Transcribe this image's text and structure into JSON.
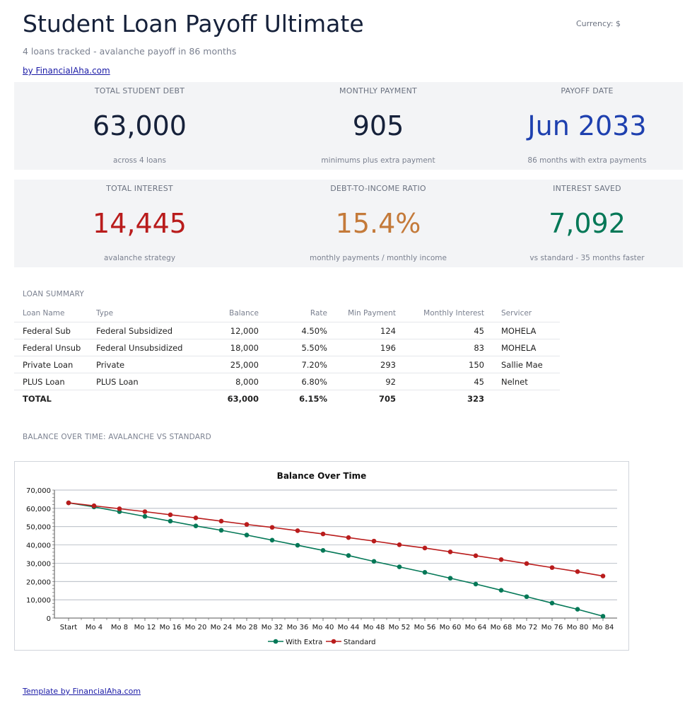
{
  "header": {
    "title": "Student Loan Payoff Ultimate",
    "subtitle": "4 loans tracked - avalanche payoff in 86 months",
    "byline": "by FinancialAha.com",
    "currency": "Currency: $"
  },
  "kpis_row1": [
    {
      "label": "TOTAL STUDENT DEBT",
      "value": "63,000",
      "note": "across 4 loans",
      "color": "#16213a"
    },
    {
      "label": "MONTHLY PAYMENT",
      "value": "905",
      "note": "minimums plus extra payment",
      "color": "#16213a"
    },
    {
      "label": "PAYOFF DATE",
      "value": "Jun 2033",
      "note": "86 months with extra payments",
      "color": "#1e40af"
    }
  ],
  "kpis_row2": [
    {
      "label": "TOTAL INTEREST",
      "value": "14,445",
      "note": "avalanche strategy",
      "color": "#b91c1c"
    },
    {
      "label": "DEBT-TO-INCOME RATIO",
      "value": "15.4%",
      "note": "monthly payments / monthly income",
      "color": "#c47a3a"
    },
    {
      "label": "INTEREST SAVED",
      "value": "7,092",
      "note": "vs standard - 35 months faster",
      "color": "#047857"
    }
  ],
  "loan_summary": {
    "section_label": "LOAN SUMMARY",
    "columns": [
      "Loan Name",
      "Type",
      "Balance",
      "Rate",
      "Min Payment",
      "Monthly Interest",
      "Servicer"
    ],
    "rows": [
      [
        "Federal Sub",
        "Federal Subsidized",
        "12,000",
        "4.50%",
        "124",
        "45",
        "MOHELA"
      ],
      [
        "Federal Unsub",
        "Federal Unsubsidized",
        "18,000",
        "5.50%",
        "196",
        "83",
        "MOHELA"
      ],
      [
        "Private Loan",
        "Private",
        "25,000",
        "7.20%",
        "293",
        "150",
        "Sallie Mae"
      ],
      [
        "PLUS Loan",
        "PLUS Loan",
        "8,000",
        "6.80%",
        "92",
        "45",
        "Nelnet"
      ]
    ],
    "total": [
      "TOTAL",
      "",
      "63,000",
      "6.15%",
      "705",
      "323",
      ""
    ]
  },
  "chart_section_label": "BALANCE OVER TIME: AVALANCHE VS STANDARD",
  "chart_data": {
    "type": "line",
    "title": "Balance Over Time",
    "categories": [
      "Start",
      "Mo 4",
      "Mo 8",
      "Mo 12",
      "Mo 16",
      "Mo 20",
      "Mo 24",
      "Mo 28",
      "Mo 32",
      "Mo 36",
      "Mo 40",
      "Mo 44",
      "Mo 48",
      "Mo 52",
      "Mo 56",
      "Mo 60",
      "Mo 64",
      "Mo 68",
      "Mo 72",
      "Mo 76",
      "Mo 80",
      "Mo 84"
    ],
    "series": [
      {
        "name": "With Extra",
        "color": "#047857",
        "values": [
          63000,
          60800,
          58200,
          55600,
          53000,
          50400,
          48000,
          45400,
          42600,
          39800,
          37000,
          34200,
          31000,
          28000,
          25000,
          21800,
          18600,
          15200,
          11700,
          8200,
          4800,
          1000
        ]
      },
      {
        "name": "Standard",
        "color": "#b91c1c",
        "values": [
          63000,
          61400,
          59800,
          58200,
          56500,
          54800,
          53000,
          51200,
          49600,
          47800,
          46000,
          44000,
          42100,
          40100,
          38300,
          36200,
          34100,
          32000,
          29800,
          27600,
          25400,
          23000
        ]
      }
    ],
    "ylim": [
      0,
      70000
    ],
    "yticks": [
      "0",
      "10,000",
      "20,000",
      "30,000",
      "40,000",
      "50,000",
      "60,000",
      "70,000"
    ],
    "grid": true,
    "legend": "bottom"
  },
  "footer": {
    "link": "Template by FinancialAha.com"
  }
}
